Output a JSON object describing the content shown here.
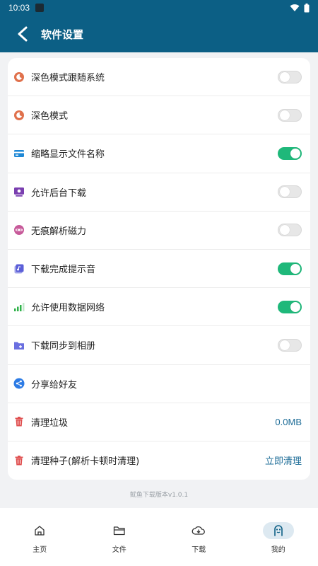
{
  "status_bar": {
    "time": "10:03"
  },
  "app_bar": {
    "title": "软件设置"
  },
  "settings": [
    {
      "label": "深色模式跟随系统",
      "icon": "moon-icon",
      "icon_color": "#e0714c",
      "toggle": false
    },
    {
      "label": "深色模式",
      "icon": "moon-icon",
      "icon_color": "#e0714c",
      "toggle": false
    },
    {
      "label": "缩略显示文件名称",
      "icon": "card-icon",
      "icon_color": "#1e88d6",
      "toggle": true
    },
    {
      "label": "允许后台下载",
      "icon": "monitor-icon",
      "icon_color": "#7a3fb0",
      "toggle": false
    },
    {
      "label": "无痕解析磁力",
      "icon": "mask-icon",
      "icon_color": "#c75a9a",
      "toggle": false
    },
    {
      "label": "下载完成提示音",
      "icon": "music-icon",
      "icon_color": "#5b5fd8",
      "toggle": true
    },
    {
      "label": "允许使用数据网络",
      "icon": "signal-icon",
      "icon_color": "#2fb24a",
      "toggle": true
    },
    {
      "label": "下载同步到相册",
      "icon": "folder-icon",
      "icon_color": "#6a6fe0",
      "toggle": false
    },
    {
      "label": "分享给好友",
      "icon": "share-icon",
      "icon_color": "#2c7be5"
    },
    {
      "label": "清理垃圾",
      "icon": "trash-icon",
      "icon_color": "#e05050",
      "value": "0.0MB"
    },
    {
      "label": "清理种子(解析卡顿时清理)",
      "icon": "trash-icon",
      "icon_color": "#e05050",
      "value": "立即清理"
    }
  ],
  "version": "鱿鱼下载版本v1.0.1",
  "tabs": [
    {
      "label": "主页",
      "icon": "home-icon"
    },
    {
      "label": "文件",
      "icon": "folder-icon"
    },
    {
      "label": "下载",
      "icon": "cloud-download-icon"
    },
    {
      "label": "我的",
      "icon": "profile-icon",
      "active": true
    }
  ],
  "colors": {
    "primary": "#0c5f85",
    "toggle_on": "#1fb87a",
    "link": "#1d6c97"
  }
}
